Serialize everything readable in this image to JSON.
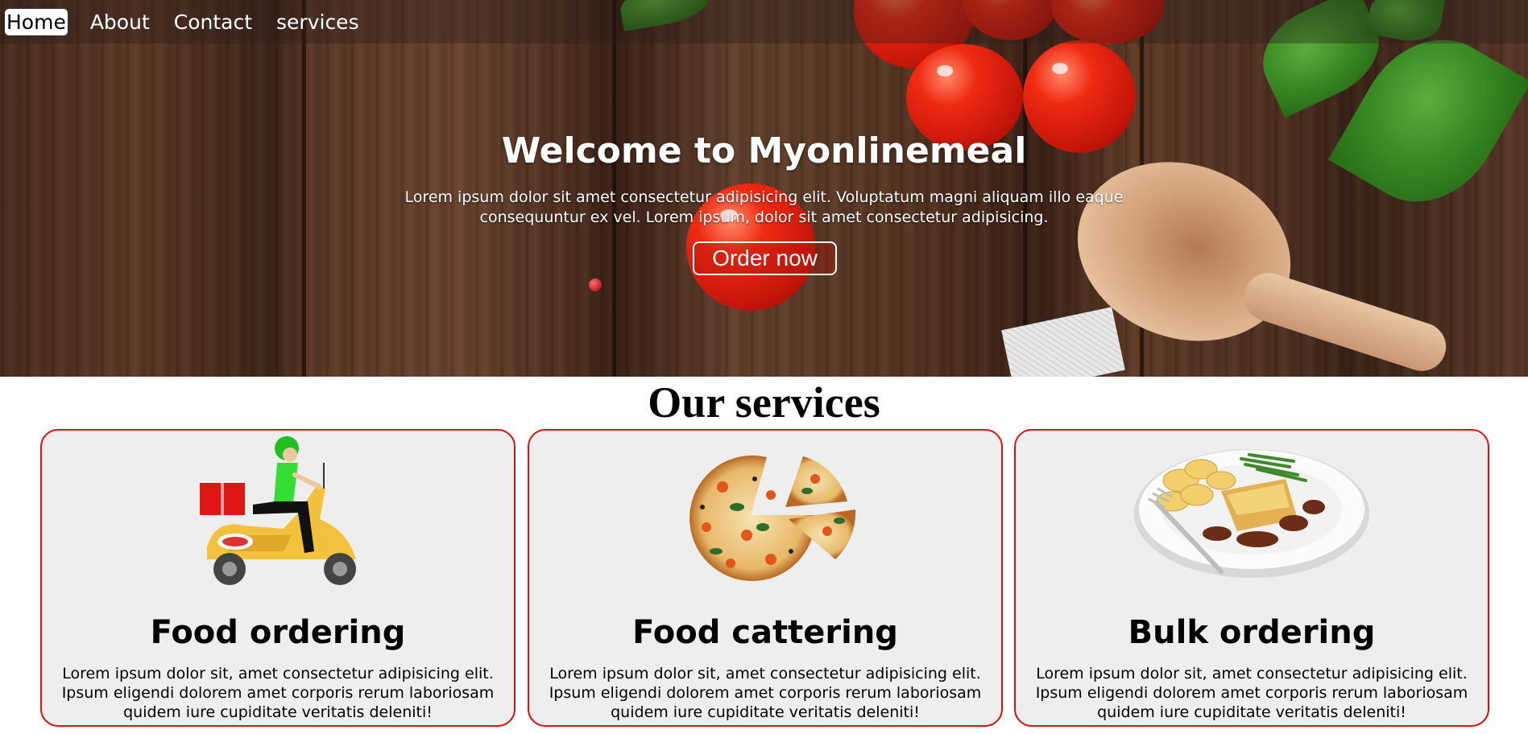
{
  "nav": {
    "items": [
      {
        "label": "Home",
        "active": true
      },
      {
        "label": "About",
        "active": false
      },
      {
        "label": "Contact",
        "active": false
      },
      {
        "label": "services",
        "active": false
      }
    ]
  },
  "hero": {
    "title": "Welcome to Myonlinemeal",
    "text": "Lorem ipsum dolor sit amet consectetur adipisicing elit. Voluptatum magni aliquam illo eaque consequuntur ex vel. Lorem ipsum, dolor sit amet consectetur adipisicing.",
    "button_label": "Order now"
  },
  "services": {
    "title": "Our services",
    "cards": [
      {
        "title": "Food ordering",
        "text": "Lorem ipsum dolor sit, amet consectetur adipisicing elit. Ipsum eligendi dolorem amet corporis rerum laboriosam quidem iure cupiditate veritatis deleniti!",
        "icon": "delivery-scooter-icon"
      },
      {
        "title": "Food cattering",
        "text": "Lorem ipsum dolor sit, amet consectetur adipisicing elit. Ipsum eligendi dolorem amet corporis rerum laboriosam quidem iure cupiditate veritatis deleniti!",
        "icon": "pizza-icon"
      },
      {
        "title": "Bulk ordering",
        "text": "Lorem ipsum dolor sit, amet consectetur adipisicing elit. Ipsum eligendi dolorem amet corporis rerum laboriosam quidem iure cupiditate veritatis deleniti!",
        "icon": "meal-plate-icon"
      }
    ]
  },
  "colors": {
    "card_border": "#e01010",
    "card_background": "#eeeeee",
    "hero_text": "#ffffff"
  }
}
